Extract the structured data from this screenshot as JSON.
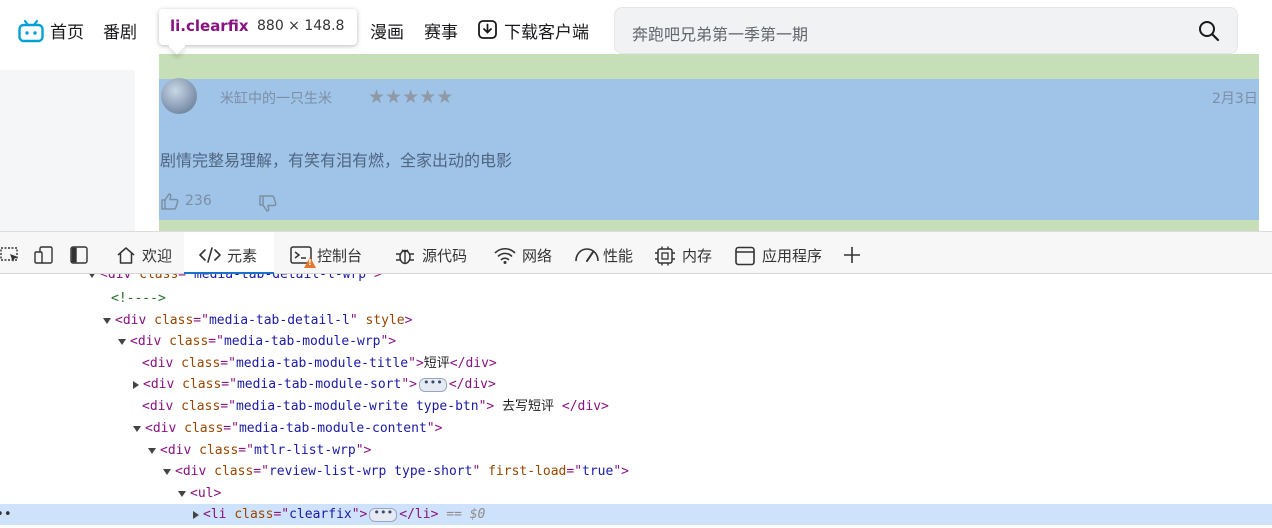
{
  "header": {
    "nav": [
      "首页",
      "番剧",
      "漫画",
      "赛事",
      "下载客户端"
    ],
    "search_placeholder": "奔跑吧兄弟第一季第一期"
  },
  "inspect_tooltip": {
    "selector": "li.clearfix",
    "dimensions": "880 × 148.8"
  },
  "review": {
    "username": "米缸中的一只生米",
    "stars": 5,
    "date": "2月3日",
    "text": "剧情完整易理解，有笑有泪有燃，全家出动的电影",
    "likes": "236"
  },
  "devtools": {
    "tabs": [
      "欢迎",
      "元素",
      "控制台",
      "源代码",
      "网络",
      "性能",
      "内存",
      "应用程序"
    ],
    "active_tab": "元素",
    "selected_suffix": "== $0",
    "dom": [
      {
        "parts": [
          [
            "tag",
            "<div "
          ],
          [
            "attr",
            "class"
          ],
          [
            "tag",
            "=\""
          ],
          [
            "val",
            "media-tab-detail-l-wrp"
          ],
          [
            "tag",
            "\">"
          ]
        ]
      },
      {
        "parts": [
          [
            "cmt",
            "<!---->"
          ]
        ]
      },
      {
        "parts": [
          [
            "tag",
            "<div "
          ],
          [
            "attr",
            "class"
          ],
          [
            "tag",
            "=\""
          ],
          [
            "val",
            "media-tab-detail-l"
          ],
          [
            "tag",
            "\" "
          ],
          [
            "attr",
            "style"
          ],
          [
            "tag",
            ">"
          ]
        ]
      },
      {
        "parts": [
          [
            "tag",
            "<div "
          ],
          [
            "attr",
            "class"
          ],
          [
            "tag",
            "=\""
          ],
          [
            "val",
            "media-tab-module-wrp"
          ],
          [
            "tag",
            "\">"
          ]
        ]
      },
      {
        "parts": [
          [
            "tag",
            "<div "
          ],
          [
            "attr",
            "class"
          ],
          [
            "tag",
            "=\""
          ],
          [
            "val",
            "media-tab-module-title"
          ],
          [
            "tag",
            "\">"
          ],
          [
            "txt",
            "短评"
          ],
          [
            "tag",
            "</div>"
          ]
        ]
      },
      {
        "parts": [
          [
            "tag",
            "<div "
          ],
          [
            "attr",
            "class"
          ],
          [
            "tag",
            "=\""
          ],
          [
            "val",
            "media-tab-module-sort"
          ],
          [
            "tag",
            "\">"
          ]
        ]
      },
      {
        "parts": [
          [
            "tag",
            "<div "
          ],
          [
            "attr",
            "class"
          ],
          [
            "tag",
            "=\""
          ],
          [
            "val",
            "media-tab-module-write type-btn"
          ],
          [
            "tag",
            "\">"
          ],
          [
            "txt",
            " 去写短评 "
          ],
          [
            "tag",
            "</div>"
          ]
        ]
      },
      {
        "parts": [
          [
            "tag",
            "<div "
          ],
          [
            "attr",
            "class"
          ],
          [
            "tag",
            "=\""
          ],
          [
            "val",
            "media-tab-module-content"
          ],
          [
            "tag",
            "\">"
          ]
        ]
      },
      {
        "parts": [
          [
            "tag",
            "<div "
          ],
          [
            "attr",
            "class"
          ],
          [
            "tag",
            "=\""
          ],
          [
            "val",
            "mtlr-list-wrp"
          ],
          [
            "tag",
            "\">"
          ]
        ]
      },
      {
        "parts": [
          [
            "tag",
            "<div "
          ],
          [
            "attr",
            "class"
          ],
          [
            "tag",
            "=\""
          ],
          [
            "val",
            "review-list-wrp type-short"
          ],
          [
            "tag",
            "\" "
          ],
          [
            "attr",
            "first-load"
          ],
          [
            "tag",
            "=\""
          ],
          [
            "val",
            "true"
          ],
          [
            "tag",
            "\">"
          ]
        ]
      },
      {
        "parts": [
          [
            "tag",
            "<ul>"
          ]
        ]
      },
      {
        "parts": [
          [
            "tag",
            "<li "
          ],
          [
            "attr",
            "class"
          ],
          [
            "tag",
            "=\""
          ],
          [
            "val",
            "clearfix"
          ],
          [
            "tag",
            "\">"
          ]
        ]
      }
    ],
    "dom_tails": {
      "5": "</div>",
      "11": "</li>"
    }
  }
}
